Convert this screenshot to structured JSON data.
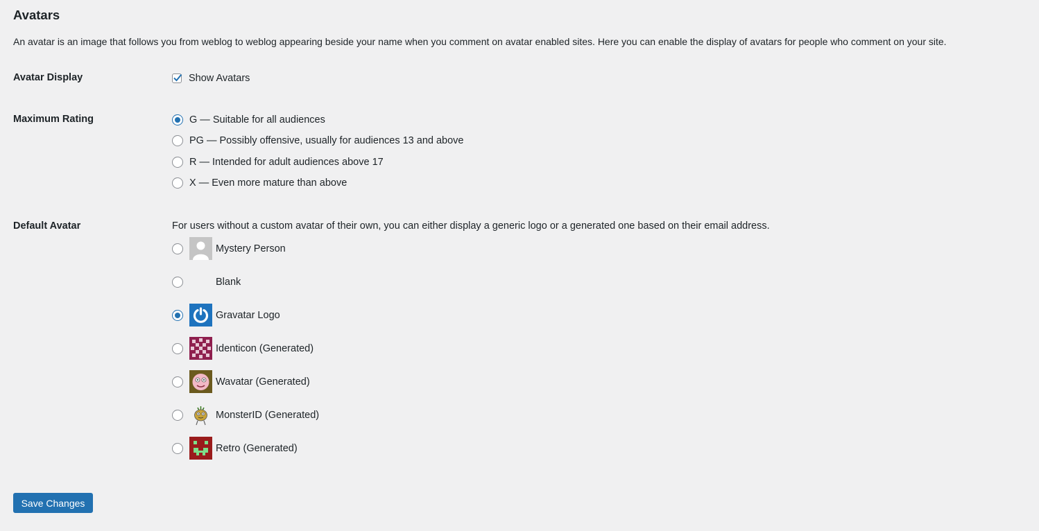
{
  "section": {
    "title": "Avatars",
    "description": "An avatar is an image that follows you from weblog to weblog appearing beside your name when you comment on avatar enabled sites. Here you can enable the display of avatars for people who comment on your site."
  },
  "avatar_display": {
    "label": "Avatar Display",
    "checkbox_label": "Show Avatars",
    "checked": true
  },
  "maximum_rating": {
    "label": "Maximum Rating",
    "selected": "G",
    "options": [
      {
        "value": "G",
        "label": "G — Suitable for all audiences"
      },
      {
        "value": "PG",
        "label": "PG — Possibly offensive, usually for audiences 13 and above"
      },
      {
        "value": "R",
        "label": "R — Intended for adult audiences above 17"
      },
      {
        "value": "X",
        "label": "X — Even more mature than above"
      }
    ]
  },
  "default_avatar": {
    "label": "Default Avatar",
    "description": "For users without a custom avatar of their own, you can either display a generic logo or a generated one based on their email address.",
    "selected": "gravatar_default",
    "options": [
      {
        "value": "mystery",
        "label": "Mystery Person",
        "icon": "mystery-person-avatar-icon"
      },
      {
        "value": "blank",
        "label": "Blank",
        "icon": "blank-avatar-icon"
      },
      {
        "value": "gravatar_default",
        "label": "Gravatar Logo",
        "icon": "gravatar-logo-icon"
      },
      {
        "value": "identicon",
        "label": "Identicon (Generated)",
        "icon": "identicon-avatar-icon"
      },
      {
        "value": "wavatar",
        "label": "Wavatar (Generated)",
        "icon": "wavatar-avatar-icon"
      },
      {
        "value": "monsterid",
        "label": "MonsterID (Generated)",
        "icon": "monsterid-avatar-icon"
      },
      {
        "value": "retro",
        "label": "Retro (Generated)",
        "icon": "retro-avatar-icon"
      }
    ]
  },
  "actions": {
    "save_label": "Save Changes"
  },
  "colors": {
    "accent": "#2271b1",
    "background": "#f0f0f1",
    "text": "#1d2327"
  }
}
